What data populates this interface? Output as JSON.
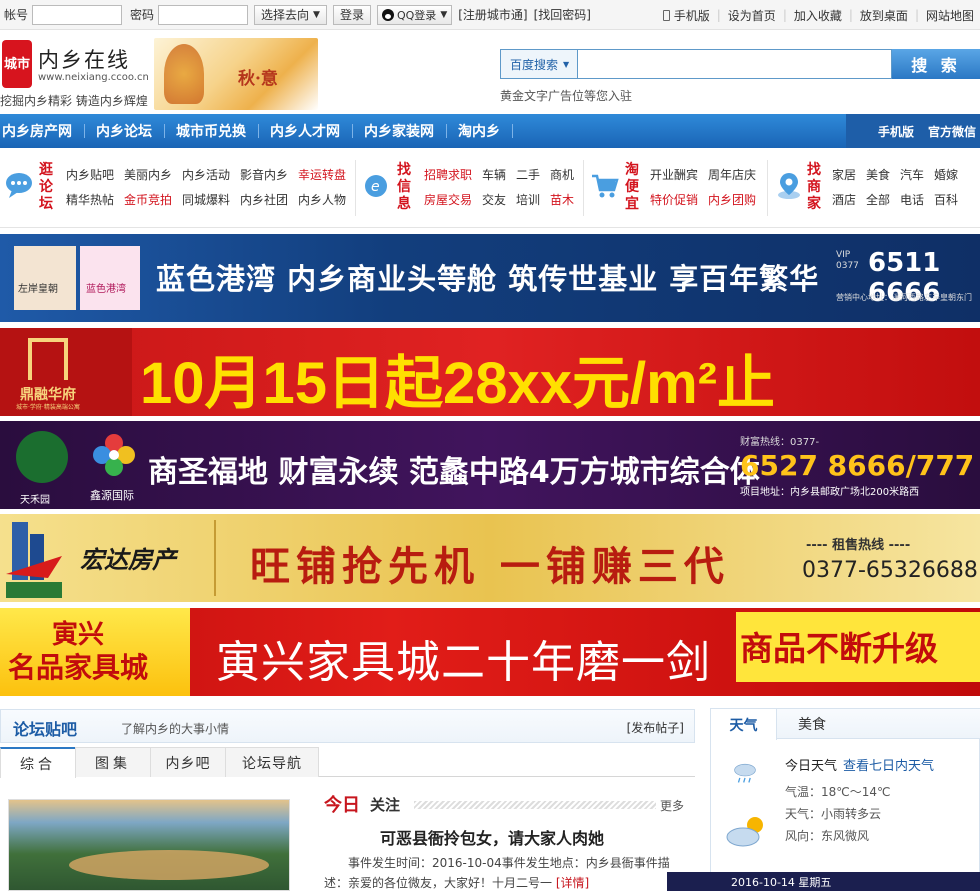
{
  "topbar": {
    "account_label": "帐号",
    "password_label": "密码",
    "goto_label": "选择去向",
    "login_label": "登录",
    "qq_label": "QQ登录",
    "register": "[注册城市通]",
    "retrieve": "[找回密码]",
    "links": [
      "手机版",
      "设为首页",
      "加入收藏",
      "放到桌面",
      "网站地图"
    ]
  },
  "header": {
    "logo_text": "城市",
    "site_name": "内乡在线",
    "site_url": "www.neixiang.ccoo.cn",
    "slogan": "挖掘内乡精彩 铸造内乡辉煌",
    "season": "秋·意",
    "search_type": "百度搜索",
    "search_button": "搜 索",
    "ad_text": "黄金文字广告位等您入驻"
  },
  "nav": {
    "items": [
      "内乡房产网",
      "内乡论坛",
      "城市币兑换",
      "内乡人才网",
      "内乡家装网",
      "淘内乡"
    ],
    "right": [
      "手机版",
      "官方微信"
    ]
  },
  "categories": [
    {
      "title": "逛论坛",
      "row1": [
        "内乡贴吧",
        "美丽内乡",
        "内乡活动",
        "影音内乡",
        "幸运转盘"
      ],
      "row2": [
        "精华热帖",
        "金币竞拍",
        "同城爆料",
        "内乡社团",
        "内乡人物"
      ]
    },
    {
      "title": "找信息",
      "row1": [
        "招聘求职",
        "车辆",
        "二手",
        "商机"
      ],
      "row2": [
        "房屋交易",
        "交友",
        "培训",
        "苗木"
      ]
    },
    {
      "title": "淘便宜",
      "row1": [
        "开业酬宾",
        "周年店庆"
      ],
      "row2": [
        "特价促销",
        "内乡团购"
      ]
    },
    {
      "title": "找商家",
      "row1": [
        "家居",
        "美食",
        "汽车",
        "婚嫁"
      ],
      "row2": [
        "酒店",
        "全部",
        "电话",
        "百科"
      ]
    }
  ],
  "banners": {
    "b1": {
      "brand_a": "左岸皇朝",
      "brand_b": "蓝色港湾",
      "slogan": "蓝色港湾 内乡商业头等舱 筑传世基业 享百年繁华",
      "vip": "VIP 0377",
      "phone": "6511 6666",
      "addr": "营销中心地址：湍河西路左岸皇朝东门"
    },
    "b2": {
      "brand": "鼎融华府",
      "sub": "城市·学府·精装高端公寓",
      "headline": "10月15日起28xx元/m²止"
    },
    "b3": {
      "brand_a": "天禾园",
      "brand_b": "鑫源国际",
      "headline": "商圣福地 财富永续 范蠡中路4万方城市综合体",
      "hot": "财富热线：0377-",
      "phone": "6527 8666/777",
      "addr": "项目地址：内乡县邮政广场北200米路西"
    },
    "b4": {
      "brand": "宏达房产",
      "headline": "旺铺抢先机 一铺赚三代",
      "hot": "---- 租售热线 ----",
      "phone": "0377-65326688"
    },
    "b5": {
      "brand_top": "寅兴",
      "brand_bottom": "名品家具城",
      "headline": "寅兴家具城二十年磨一剑",
      "right": "商品不断升级"
    }
  },
  "forum": {
    "title": "论坛贴吧",
    "subtitle": "了解内乡的大事小情",
    "post_link": "[发布帖子]",
    "tabs": [
      "综合",
      "图集",
      "内乡吧",
      "论坛导航"
    ],
    "today": "今日",
    "attention": "关注",
    "more": "更多",
    "headline": "可恶县衙拎包女，请大家人肉她",
    "desc": "事件发生时间：2016-10-04事件发生地点：内乡县衙事件描述：亲爱的各位微友，大家好！十月二号一",
    "detail": "[详情]"
  },
  "weather": {
    "tabs": [
      "天气",
      "美食"
    ],
    "today_label": "今日天气",
    "week_link": "查看七日内天气",
    "temp": "气温：18℃～14℃",
    "cond": "天气：小雨转多云",
    "wind": "风向：东风微风",
    "bottom": "2016-10-14 星期五"
  }
}
